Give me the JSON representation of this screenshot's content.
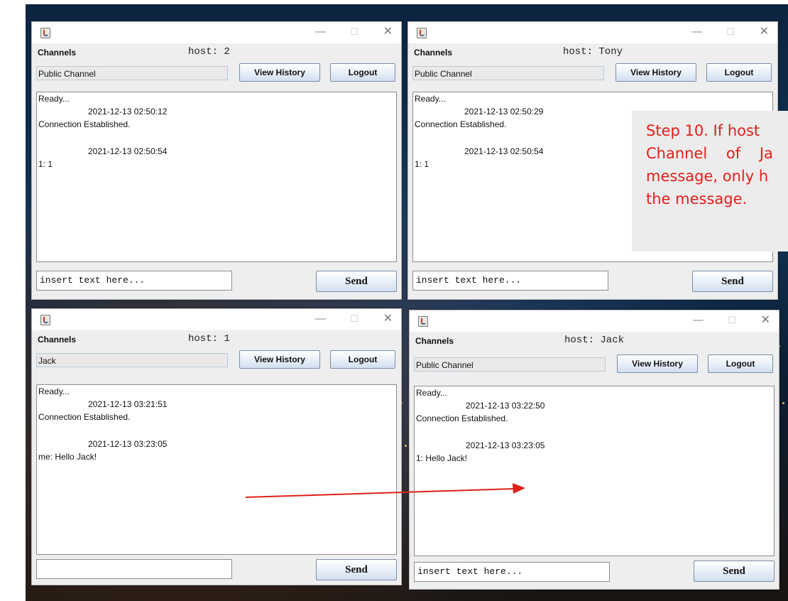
{
  "windows": [
    {
      "id": "w1",
      "channels_label": "Channels",
      "host": "host: 2",
      "channel": "Public Channel",
      "view_history": "View History",
      "logout": "Logout",
      "messages": [
        "Ready...",
        "2021-12-13 02:50:12",
        "Connection Established.",
        "2021-12-13 02:50:54",
        "1: 1"
      ],
      "input_value": "insert text here...",
      "send": "Send"
    },
    {
      "id": "w2",
      "channels_label": "Channels",
      "host": "host: Tony",
      "channel": "Public Channel",
      "view_history": "View History",
      "logout": "Logout",
      "messages": [
        "Ready...",
        "2021-12-13 02:50:29",
        "Connection Established.",
        "2021-12-13 02:50:54",
        "1: 1"
      ],
      "input_value": "insert text here...",
      "send": "Send"
    },
    {
      "id": "w3",
      "channels_label": "Channels",
      "host": "host: 1",
      "channel": "Jack",
      "view_history": "View History",
      "logout": "Logout",
      "messages": [
        "Ready...",
        "2021-12-13 03:21:51",
        "Connection Established.",
        "2021-12-13 03:23:05",
        "me: Hello Jack!"
      ],
      "input_value": "",
      "send": "Send"
    },
    {
      "id": "w4",
      "channels_label": "Channels",
      "host": "host: Jack",
      "channel": "Public Channel",
      "view_history": "View History",
      "logout": "Logout",
      "messages": [
        "Ready...",
        "2021-12-13 03:22:50",
        "Connection Established.",
        "2021-12-13 03:23:05",
        "1: Hello Jack!"
      ],
      "input_value": "insert text here...",
      "send": "Send"
    }
  ],
  "callout": {
    "lines": [
      "Step 10. If host",
      "Channel    of    Ja",
      "message, only h",
      "the message."
    ]
  },
  "colors": {
    "annotation": "#e0201a",
    "button_border": "#7a8ea8"
  },
  "icons": {
    "app": "java-cup-icon",
    "minimize": "minimize-icon",
    "maximize": "maximize-icon",
    "close": "close-icon"
  }
}
